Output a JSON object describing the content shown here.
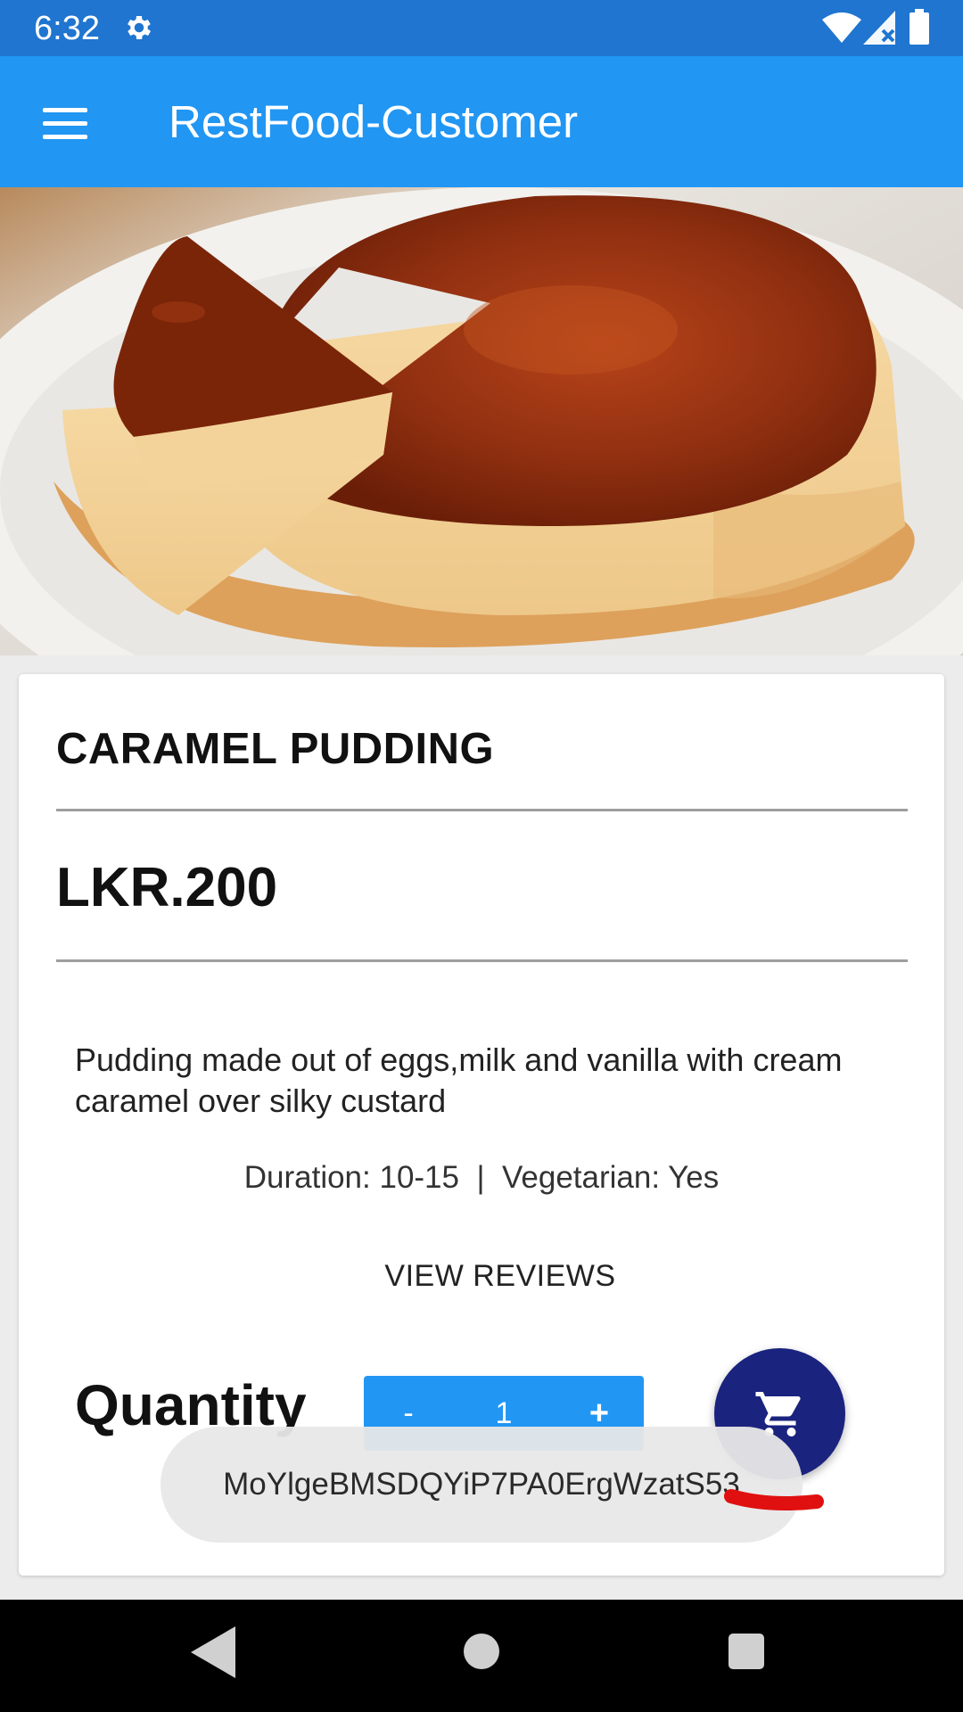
{
  "status_bar": {
    "time": "6:32",
    "icons": [
      "settings-gear-icon",
      "wifi-icon",
      "cell-signal-icon",
      "battery-icon"
    ]
  },
  "app_bar": {
    "title": "RestFood-Customer",
    "menu_icon": "hamburger-menu-icon",
    "color": "#2196f3"
  },
  "food": {
    "image": "caramel-pudding-photo",
    "name": "CARAMEL PUDDING",
    "price": "LKR.200",
    "description": "Pudding made out of eggs,milk and vanilla with cream caramel over silky custard",
    "meta": "Duration: 10-15  |  Vegetarian: Yes",
    "view_reviews_label": "VIEW REVIEWS"
  },
  "quantity": {
    "label": "Quantity",
    "minus_label": "-",
    "value": "1",
    "plus_label": "+"
  },
  "cart_button": {
    "icon": "shopping-cart-icon",
    "color": "#1a237e"
  },
  "toast": {
    "text": "MoYlgeBMSDQYiP7PA0ErgWzatS53"
  },
  "nav_bar": {
    "icons": [
      "back-triangle-icon",
      "home-circle-icon",
      "recents-square-icon"
    ]
  }
}
